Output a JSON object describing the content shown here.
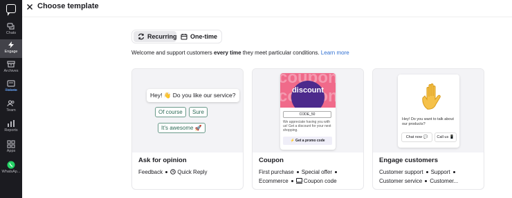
{
  "sidebar": {
    "items": [
      {
        "label": "Chats",
        "icon": "chats-icon"
      },
      {
        "label": "Engage",
        "icon": "bolt-icon",
        "active": true
      },
      {
        "label": "Archives",
        "icon": "archive-icon"
      },
      {
        "label": "Tickets",
        "icon": "ticket-icon"
      },
      {
        "label": "Team",
        "icon": "team-icon"
      },
      {
        "label": "Reports",
        "icon": "reports-icon"
      },
      {
        "label": "Apps",
        "icon": "apps-icon"
      },
      {
        "label": "WhatsAp...",
        "icon": "whatsapp-icon"
      }
    ]
  },
  "header": {
    "title": "Choose template",
    "close_icon": "close-icon"
  },
  "tabs": {
    "recurring": "Recurring",
    "one_time": "One-time"
  },
  "subtitle": {
    "before": "Welcome and support customers ",
    "bold": "every time",
    "after": " they meet particular conditions.",
    "link": "Learn more"
  },
  "cards": [
    {
      "title": "Ask for opinion",
      "tags": [
        "Feedback",
        "Quick Reply"
      ],
      "preview": {
        "question": "Hey! 👋 Do you like our service?",
        "replies": [
          "Of course",
          "Sure",
          "It's awesome 🚀"
        ]
      }
    },
    {
      "title": "Coupon",
      "tags": [
        "First purchase",
        "Special offer",
        "Ecommerce",
        "Coupon code"
      ],
      "preview": {
        "headline": "discount",
        "background_words": [
          "coupon",
          "coupon"
        ],
        "code": "CODE_50",
        "text": "We appreciate having you with us! Get a discount for your next shopping.",
        "button": "⚡ Get a promo code"
      }
    },
    {
      "title": "Engage customers",
      "tags": [
        "Customer support",
        "Support",
        "Customer service",
        "Customer..."
      ],
      "preview": {
        "text": "Hey! Do you want to talk about our products?",
        "buttons": [
          "Chat now 💬",
          "Call us 📱"
        ]
      }
    }
  ],
  "colors": {
    "sidebar_bg": "#1b1b20",
    "accent_link": "#2f6fd1",
    "coupon_pink": "#f06a8a",
    "coupon_purple": "#4c2a8c",
    "quick_reply_green": "#2d6a56",
    "whatsapp_green": "#25d366"
  }
}
